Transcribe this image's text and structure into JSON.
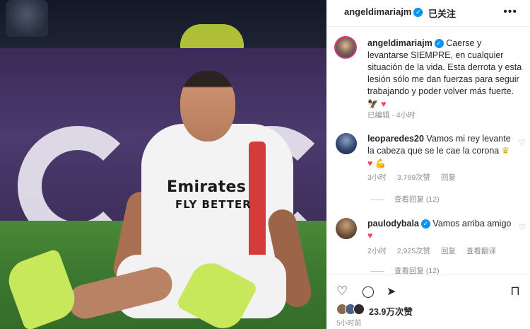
{
  "photo": {
    "sponsor_main": "Emirates",
    "sponsor_sub": "FLY BETTER"
  },
  "header": {
    "username": "angeldimariajm",
    "verified_icon": "✓",
    "separator": "·",
    "follow_status": "已关注",
    "more_icon": "•••"
  },
  "post": {
    "author": "angeldimariajm",
    "verified_icon": "✓",
    "caption": "Caerse y levantarse SIEMPRE, en cualquier situación de la vida. Esta derrota y esta lesión sólo me dan fuerzas para seguir trabajando y poder volver más fuerte.",
    "caption_emoji": "🦅",
    "caption_heart": "♥",
    "edited": "已编辑",
    "dot": "·",
    "time": "4小时"
  },
  "comments": [
    {
      "author": "leoparedes20",
      "text": "Vamos mi rey levante la cabeza que se le cae la corona",
      "emoji1": "♛",
      "emoji2": "♥",
      "emoji3": "💪",
      "time": "3小时",
      "likes": "3,769次赞",
      "reply": "回复",
      "view_replies": "查看回复 (12)"
    },
    {
      "author": "paulodybala",
      "verified_icon": "✓",
      "text": "Vamos arriba amigo",
      "emoji1": "♥",
      "time": "2小时",
      "likes": "2,925次赞",
      "reply": "回复",
      "translate": "查看翻译",
      "view_replies": "查看回复 (12)"
    }
  ],
  "actions": {
    "like_icon": "♡",
    "comment_icon": "◯",
    "share_icon": "➤",
    "save_icon": "⊓",
    "likes_count": "23.9万次赞",
    "time_ago": "5小时前"
  },
  "colors": {
    "verified": "#0095f6",
    "heart": "#ed4956",
    "muted": "#8e8e8e"
  }
}
